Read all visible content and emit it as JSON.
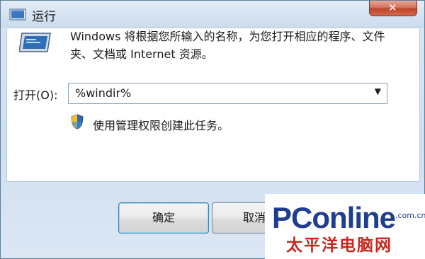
{
  "window": {
    "title": "运行"
  },
  "dialog": {
    "description": "Windows 将根据您所输入的名称，为您打开相应的程序、文件夹、文档或 Internet 资源。",
    "open_label": "打开(O):",
    "open_value": "%windir%",
    "admin_note": "使用管理权限创建此任务。"
  },
  "buttons": {
    "ok": "确定",
    "cancel": "取消"
  },
  "watermark": {
    "logo": "PConline",
    "domain": ".com.cn",
    "chinese": "太平洋电脑网"
  },
  "icons": {
    "window": "run-app-icon",
    "close": "close-icon",
    "run": "run-program-icon",
    "shield": "uac-shield-icon",
    "dropdown": "chevron-down-icon"
  },
  "colors": {
    "title_bg": "#d4e2f1",
    "close_btn": "#c0432c",
    "watermark_blue": "#1f3e90",
    "watermark_red": "#c8281e"
  }
}
